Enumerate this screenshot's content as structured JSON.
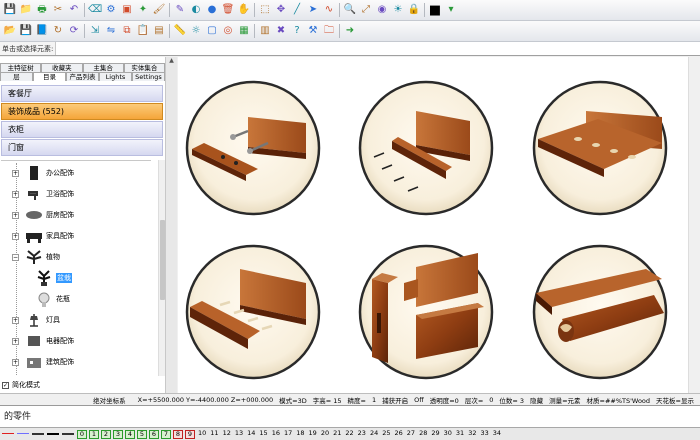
{
  "toolbar": {
    "row1": [
      "save-icon",
      "folder-icon",
      "print-icon",
      "cut-icon",
      "undo-icon",
      "eraser-icon",
      "gear-icon",
      "cube-icon",
      "wand-icon",
      "paint-icon",
      "pencil-icon",
      "palette-icon",
      "sphere-icon",
      "trash-icon",
      "hand-icon",
      "select-icon",
      "move-icon",
      "line-icon",
      "arrow-icon",
      "curve-icon",
      "zoom-icon",
      "zoom-fit-icon",
      "camera-icon",
      "light-icon",
      "lock-icon",
      "color-swatch-icon",
      "dropdown-icon"
    ],
    "row2": [
      "open-icon",
      "save2-icon",
      "book-icon",
      "refresh-icon",
      "rotate-icon",
      "scale-icon",
      "mirror-icon",
      "copy-icon",
      "paste-icon",
      "wood-icon",
      "measure-icon",
      "sun-icon",
      "box-icon",
      "eye-icon",
      "grid-icon",
      "table-icon",
      "delete-icon",
      "help-icon",
      "settings-icon",
      "folder-open-icon",
      "arrow-right-icon"
    ],
    "color_swatch": "#000000"
  },
  "command_bar": {
    "label": "单击或选择元素:",
    "value": ""
  },
  "left_panel": {
    "tabs_row1": [
      "主特征树",
      "收藏夹",
      "主集合",
      "实体集合"
    ],
    "tabs_row2": [
      "层",
      "目录",
      "产品列表",
      "Lights",
      "Settings"
    ],
    "active_tab": "目录",
    "categories": [
      {
        "label": "客餐厅",
        "selected": false
      },
      {
        "label": "装饰成品 (552)",
        "selected": true
      },
      {
        "label": "衣柜",
        "selected": false
      },
      {
        "label": "门窗",
        "selected": false
      }
    ],
    "tree": [
      {
        "label": "办公配饰",
        "icon": "vase-icon",
        "expand": "+"
      },
      {
        "label": "卫浴配饰",
        "icon": "faucet-icon",
        "expand": "+"
      },
      {
        "label": "厨房配饰",
        "icon": "plate-icon",
        "expand": "+"
      },
      {
        "label": "家具配饰",
        "icon": "furniture-icon",
        "expand": "+"
      },
      {
        "label": "植物",
        "icon": "plant-icon",
        "expand": "−"
      },
      {
        "label": "盆栽",
        "icon": "potted-plant-icon",
        "expand": "",
        "selected": true
      },
      {
        "label": "花瓶",
        "icon": "flower-vase-icon",
        "expand": ""
      },
      {
        "label": "灯具",
        "icon": "lamp-icon",
        "expand": "+"
      },
      {
        "label": "电器配饰",
        "icon": "appliance-icon",
        "expand": "+"
      },
      {
        "label": "建筑配饰",
        "icon": "building-icon",
        "expand": "+"
      }
    ],
    "simplify_mode": {
      "label": "简化模式",
      "checked": true
    }
  },
  "viewport": {
    "tiles": [
      "joint-dowel-bolts",
      "joint-nails",
      "joint-biscuit",
      "joint-dowels",
      "joint-mortise-tenon",
      "joint-tongue-groove"
    ]
  },
  "status_bar": {
    "coord_mode": "绝对坐标系",
    "coords": "X=+5500.000 Y=-4400.000 Z=+000.000",
    "mode": "模式=3D",
    "font_height": "字高= 15",
    "precision": "精度=",
    "precision_val": "1",
    "snap": "捕获开启",
    "snap_val": "Off",
    "transparency": "透明度=0",
    "layer": "层次=",
    "layer_val": "0",
    "digits": "位数= 3",
    "hide": "隐藏",
    "measure": "测量=元素",
    "material": "材质=##%TS'Wood",
    "ceiling": "天花板=显示"
  },
  "command_output": "的零件",
  "layer_bar": {
    "line_styles": [
      "#e02020",
      "#7070ff",
      "#333333",
      "#000000",
      "#333333"
    ],
    "numbers": [
      {
        "n": "0",
        "state": "on"
      },
      {
        "n": "1",
        "state": "on"
      },
      {
        "n": "2",
        "state": "on"
      },
      {
        "n": "3",
        "state": "on"
      },
      {
        "n": "4",
        "state": "on"
      },
      {
        "n": "5",
        "state": "on"
      },
      {
        "n": "6",
        "state": "on"
      },
      {
        "n": "7",
        "state": "on"
      },
      {
        "n": "8",
        "state": "on2"
      },
      {
        "n": "9",
        "state": "on2"
      },
      {
        "n": "10",
        "state": "plain"
      },
      {
        "n": "11",
        "state": "plain"
      },
      {
        "n": "12",
        "state": "plain"
      },
      {
        "n": "13",
        "state": "plain"
      },
      {
        "n": "14",
        "state": "plain"
      },
      {
        "n": "15",
        "state": "plain"
      },
      {
        "n": "16",
        "state": "plain"
      },
      {
        "n": "17",
        "state": "plain"
      },
      {
        "n": "18",
        "state": "plain"
      },
      {
        "n": "19",
        "state": "plain"
      },
      {
        "n": "20",
        "state": "plain"
      },
      {
        "n": "21",
        "state": "plain"
      },
      {
        "n": "22",
        "state": "plain"
      },
      {
        "n": "23",
        "state": "plain"
      },
      {
        "n": "24",
        "state": "plain"
      },
      {
        "n": "25",
        "state": "plain"
      },
      {
        "n": "26",
        "state": "plain"
      },
      {
        "n": "27",
        "state": "plain"
      },
      {
        "n": "28",
        "state": "plain"
      },
      {
        "n": "29",
        "state": "plain"
      },
      {
        "n": "30",
        "state": "plain"
      },
      {
        "n": "31",
        "state": "plain"
      },
      {
        "n": "32",
        "state": "plain"
      },
      {
        "n": "33",
        "state": "plain"
      },
      {
        "n": "34",
        "state": "plain"
      }
    ]
  }
}
